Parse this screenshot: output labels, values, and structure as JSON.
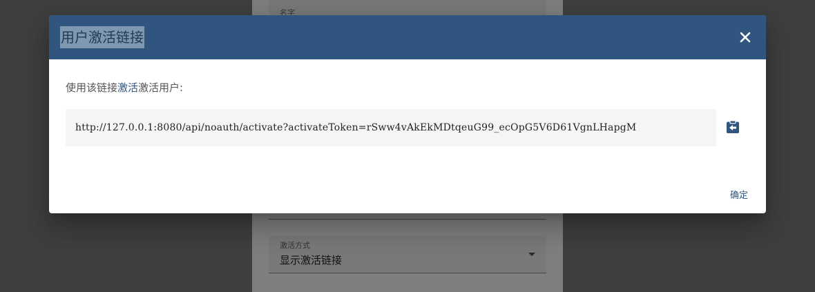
{
  "background_form": {
    "name_label": "名字",
    "method_label": "激活方式",
    "method_value": "显示激活链接"
  },
  "dialog": {
    "title": "用户激活链接",
    "hint_prefix": "使用该链接",
    "hint_link": "激活",
    "hint_suffix": "激活用户:",
    "activation_link": "http://127.0.0.1:8080/api/noauth/activate?activateToken=rSww4vAkEkMDtqeuG99_ecOpG5V6D61VgnLHapgM",
    "ok_label": "确定"
  },
  "icons": {
    "close": "close-icon",
    "copy": "clipboard-copy-icon"
  },
  "colors": {
    "header": "#305680",
    "accent": "#305680"
  }
}
